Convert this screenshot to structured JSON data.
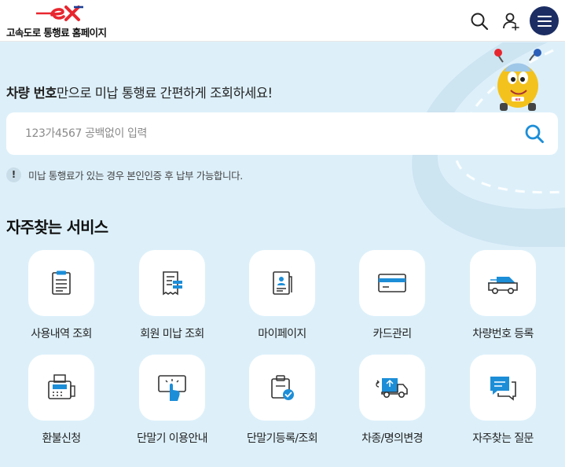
{
  "header": {
    "logo_text": "고속도로 통행료 홈페이지",
    "icons": {
      "search": "search-icon",
      "user": "user-icon",
      "menu": "hamburger-menu-icon"
    }
  },
  "hero": {
    "headline_bold": "차량 번호",
    "headline_rest": "만으로 미납 통행료 간편하게 조회하세요!"
  },
  "search": {
    "placeholder": "123가4567 공백없이 입력",
    "value": ""
  },
  "notice": {
    "icon": "!",
    "text": "미납 통행료가 있는 경우 본인인증 후 납부 가능합니다."
  },
  "services": {
    "title": "자주찾는 서비스",
    "items": [
      {
        "label": "사용내역 조회",
        "icon": "clipboard-list-icon"
      },
      {
        "label": "회원 미납 조회",
        "icon": "receipt-icon"
      },
      {
        "label": "마이페이지",
        "icon": "id-card-icon"
      },
      {
        "label": "카드관리",
        "icon": "credit-card-icon"
      },
      {
        "label": "차량번호 등록",
        "icon": "car-icon"
      },
      {
        "label": "환불신청",
        "icon": "printer-refund-icon"
      },
      {
        "label": "단말기 이용안내",
        "icon": "touch-terminal-icon"
      },
      {
        "label": "단말기등록/조회",
        "icon": "device-check-icon"
      },
      {
        "label": "차종/명의변경",
        "icon": "truck-icon"
      },
      {
        "label": "자주찾는 질문",
        "icon": "chat-bubble-icon"
      }
    ]
  },
  "colors": {
    "brand_red": "#e8262f",
    "accent_blue": "#1c8ed8",
    "navy": "#1b2d63",
    "background": "#ddf0fa"
  }
}
